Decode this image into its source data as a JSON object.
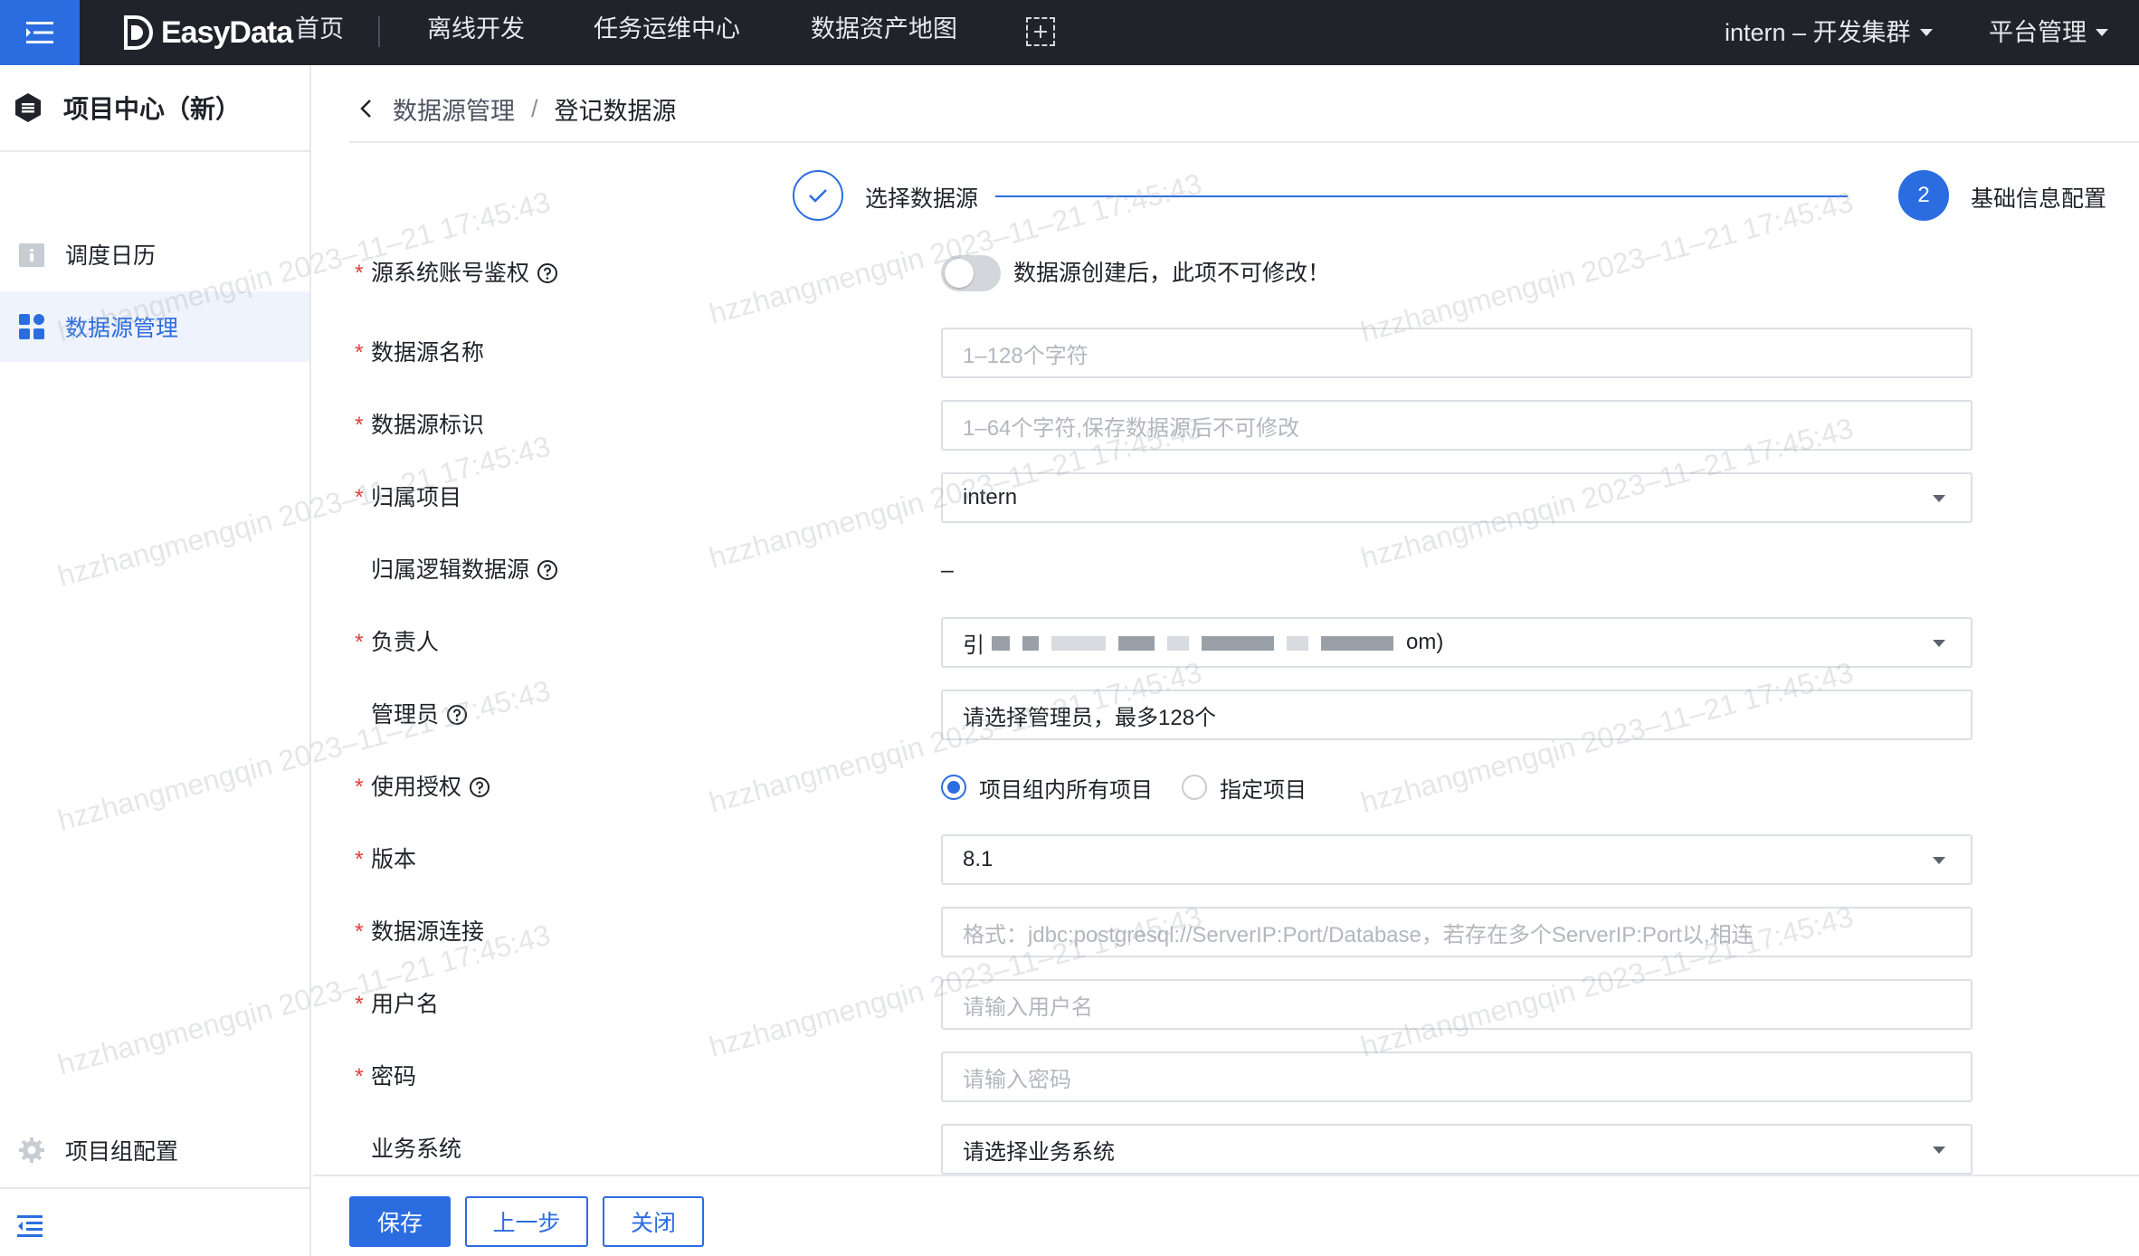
{
  "topbar": {
    "logo_text": "EasyData",
    "nav": [
      "首页",
      "离线开发",
      "任务运维中心",
      "数据资产地图"
    ],
    "cluster": "intern – 开发集群",
    "platform_admin": "平台管理"
  },
  "sidebar": {
    "title": "项目中心（新）",
    "items": [
      {
        "label": "调度日历"
      },
      {
        "label": "数据源管理"
      }
    ],
    "bottom_item": "项目组配置"
  },
  "breadcrumb": {
    "parent": "数据源管理",
    "separator": "/",
    "current": "登记数据源"
  },
  "steps": [
    {
      "label": "选择数据源",
      "status": "done"
    },
    {
      "label": "基础信息配置",
      "number": "2",
      "status": "active"
    }
  ],
  "form": {
    "auth_toggle": {
      "label": "源系统账号鉴权",
      "tip": "数据源创建后，此项不可修改！"
    },
    "name": {
      "label": "数据源名称",
      "placeholder": "1–128个字符"
    },
    "identifier": {
      "label": "数据源标识",
      "placeholder": "1–64个字符,保存数据源后不可修改"
    },
    "project": {
      "label": "归属项目",
      "value": "intern"
    },
    "logical_source": {
      "label": "归属逻辑数据源",
      "value": "–"
    },
    "owner": {
      "label": "负责人",
      "value_prefix": "引",
      "value_suffix": "om)"
    },
    "admin": {
      "label": "管理员",
      "placeholder": "请选择管理员，最多128个"
    },
    "usage_auth": {
      "label": "使用授权",
      "options": [
        "项目组内所有项目",
        "指定项目"
      ],
      "selected": 0
    },
    "version": {
      "label": "版本",
      "value": "8.1"
    },
    "connection": {
      "label": "数据源连接",
      "placeholder": "格式：jdbc:postgresql://ServerIP:Port/Database，若存在多个ServerIP:Port以,相连"
    },
    "username": {
      "label": "用户名",
      "placeholder": "请输入用户名"
    },
    "password": {
      "label": "密码",
      "placeholder": "请输入密码"
    },
    "business_system": {
      "label": "业务系统",
      "placeholder": "请选择业务系统"
    }
  },
  "footer": {
    "save": "保存",
    "prev": "上一步",
    "close": "关闭"
  },
  "watermark": "hzzhangmengqin 2023–11–21 17:45:43",
  "colors": {
    "primary": "#2b6de0",
    "topbar": "#20232a",
    "required": "#e2413a"
  }
}
